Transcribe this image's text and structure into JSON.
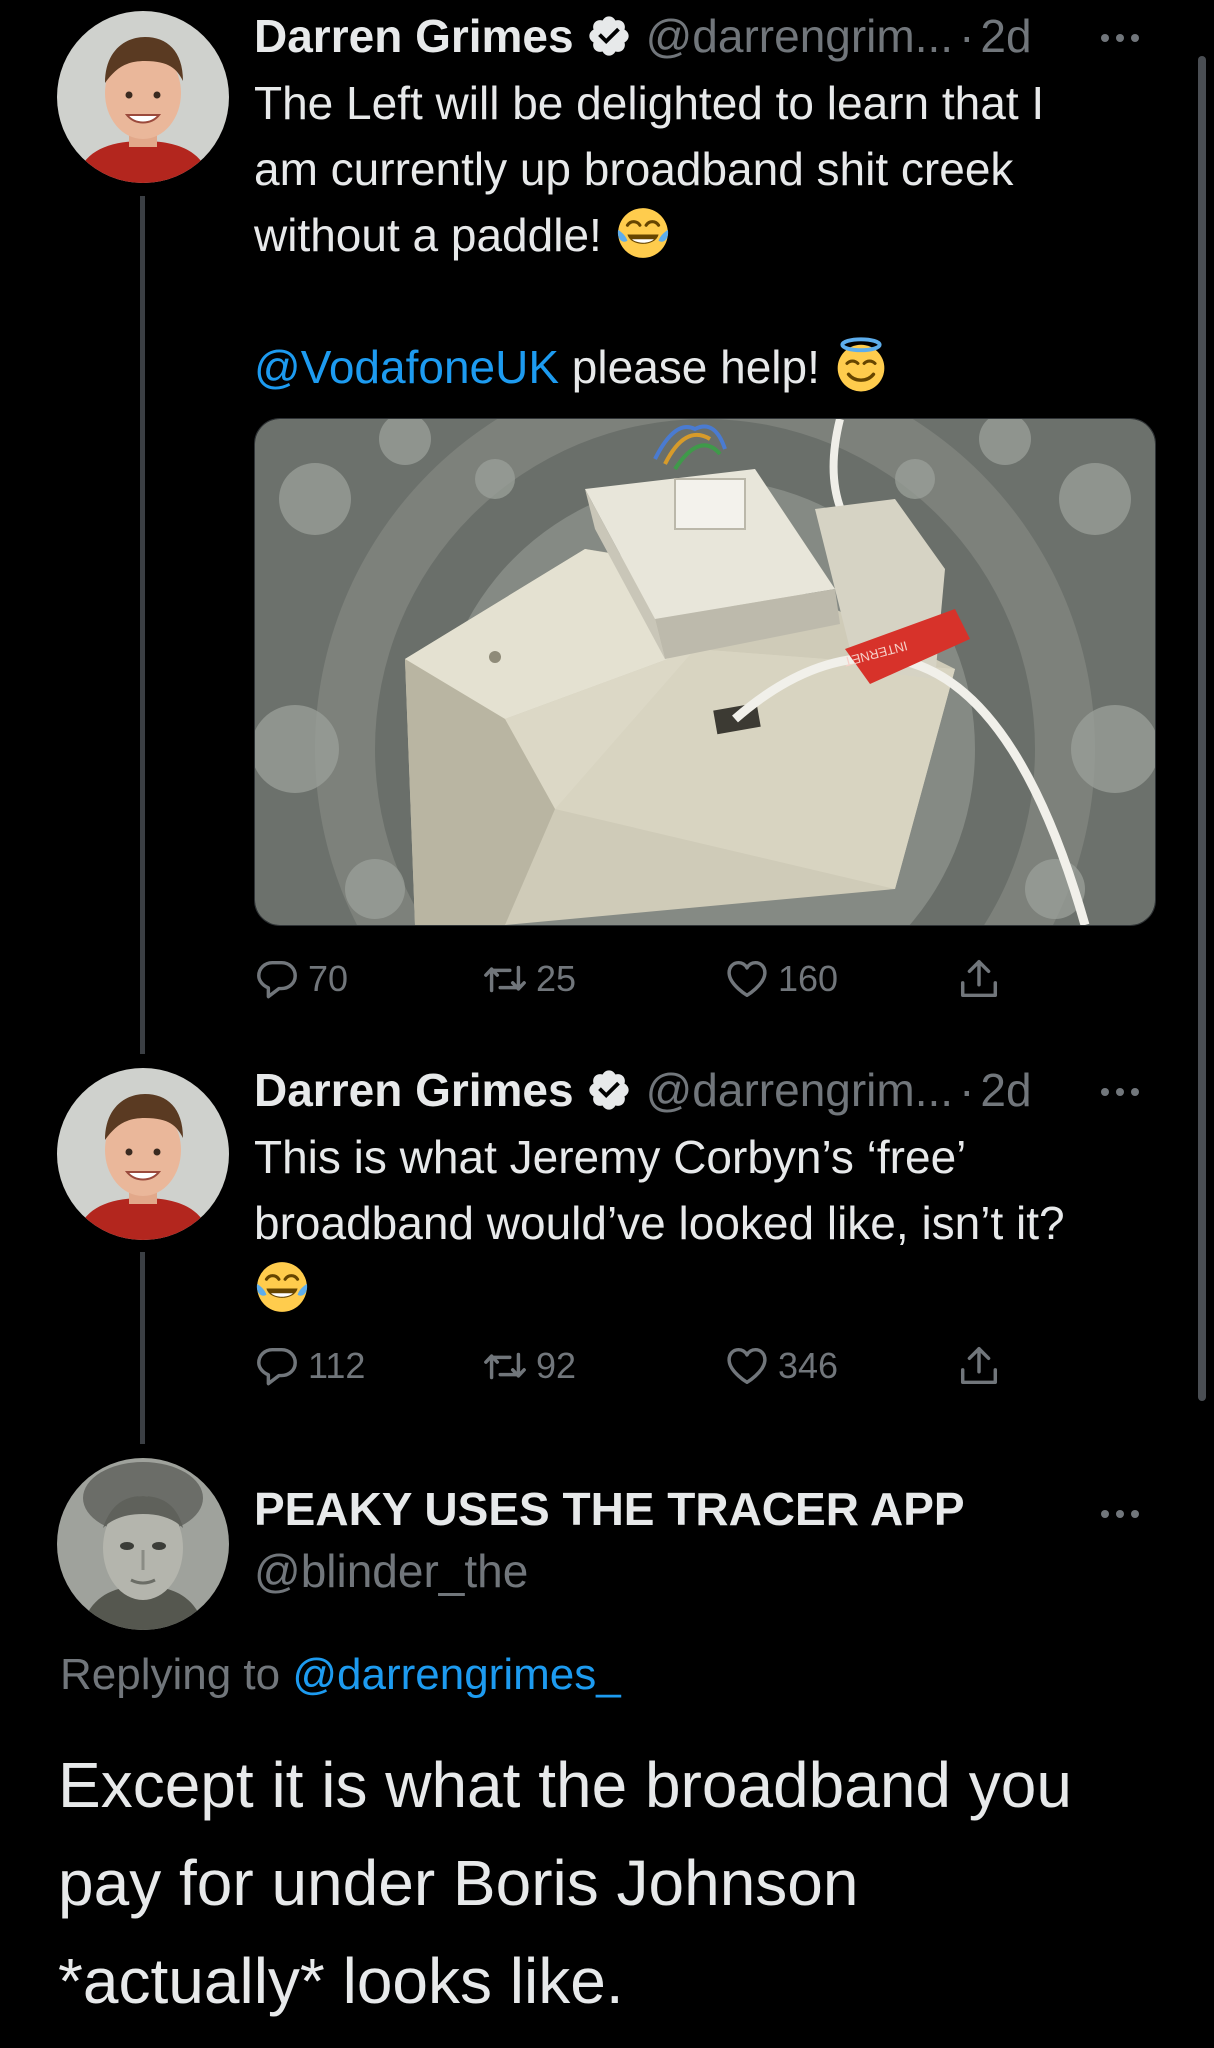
{
  "tweets": [
    {
      "author_name": "Darren Grimes",
      "author_handle": "@darrengrim...",
      "separator": "·",
      "time": "2d",
      "text_line1": "The Left will be delighted to learn that I",
      "text_line2": "am currently up broadband shit creek",
      "text_line3": "without a paddle!",
      "mention": "@VodafoneUK",
      "text_after_mention": " please help!",
      "media_label": "INTERNET",
      "replies": "70",
      "retweets": "25",
      "likes": "160"
    },
    {
      "author_name": "Darren Grimes",
      "author_handle": "@darrengrim...",
      "separator": "·",
      "time": "2d",
      "text_line1": "This is what Jeremy Corbyn’s ‘free’",
      "text_line2": "broadband would’ve looked like, isn’t it?",
      "replies": "112",
      "retweets": "92",
      "likes": "346"
    }
  ],
  "reply": {
    "author_name": "PEAKY USES THE TRACER APP",
    "author_handle": "@blinder_the",
    "replying_prefix": "Replying to ",
    "replying_handle": "@darrengrimes_",
    "text_line1": "Except it is what the broadband you",
    "text_line2": "pay for under Boris Johnson",
    "text_line3": "*actually* looks like."
  },
  "icons": {
    "verified": "verified-badge-icon",
    "reply": "reply-icon",
    "retweet": "retweet-icon",
    "like": "heart-icon",
    "share": "share-icon",
    "more": "more-icon",
    "emoji_laugh": "face-with-tears-of-joy-emoji",
    "emoji_halo": "smiling-face-with-halo-emoji"
  },
  "colors": {
    "background": "#000000",
    "text": "#e7e9ea",
    "secondary": "#71767b",
    "link": "#1d9bf0",
    "verified": "#e7e9ea",
    "thread_line": "#3b3f44"
  }
}
